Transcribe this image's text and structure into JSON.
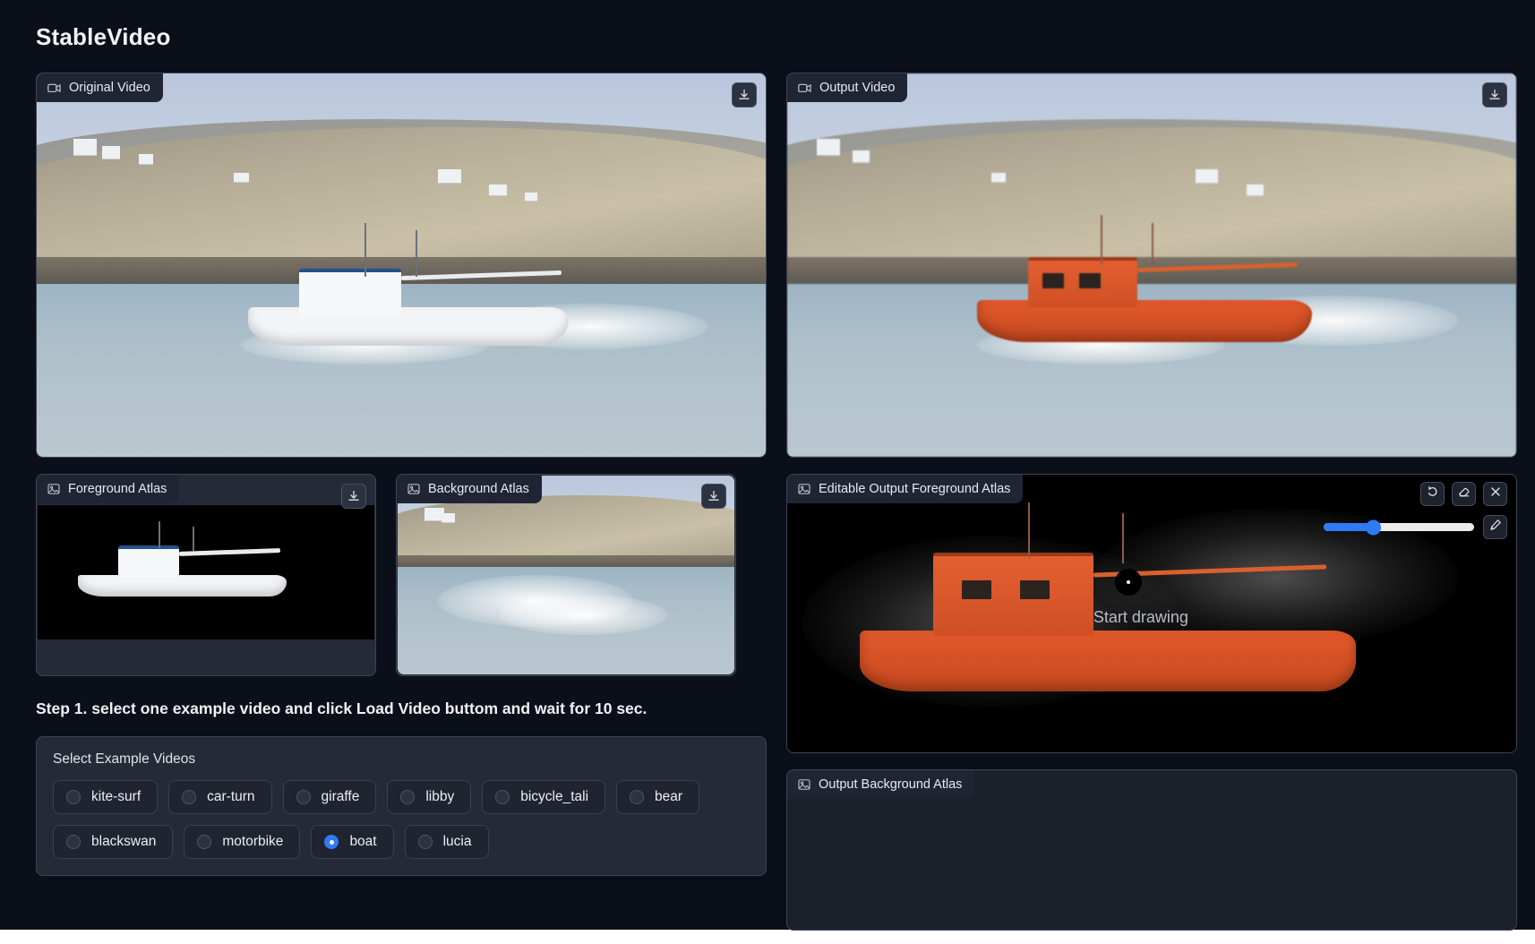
{
  "app": {
    "title": "StableVideo",
    "background_color": "#0b0f19",
    "accent_color": "#2f7bf6"
  },
  "panels": {
    "original_video": {
      "label": "Original Video",
      "icon": "video-camera-icon",
      "download_icon": "download-icon"
    },
    "output_video": {
      "label": "Output Video",
      "icon": "video-camera-icon",
      "download_icon": "download-icon"
    },
    "foreground_atlas": {
      "label": "Foreground Atlas",
      "icon": "image-icon",
      "download_icon": "download-icon"
    },
    "background_atlas": {
      "label": "Background Atlas",
      "icon": "image-icon",
      "download_icon": "download-icon"
    },
    "editable_output_foreground_atlas": {
      "label": "Editable Output Foreground Atlas",
      "icon": "image-icon",
      "hint": "Start drawing",
      "tools": [
        {
          "name": "undo-icon",
          "label": "Undo"
        },
        {
          "name": "eraser-icon",
          "label": "Erase"
        },
        {
          "name": "close-icon",
          "label": "Clear"
        }
      ],
      "brush": {
        "slider_value": 33,
        "slider_min": 0,
        "slider_max": 100,
        "pen_icon": "pen-icon"
      }
    },
    "output_background_atlas": {
      "label": "Output Background Atlas",
      "icon": "image-icon"
    }
  },
  "instructions": {
    "step1": "Step 1. select one example video and click Load Video buttom and wait for 10 sec."
  },
  "example_videos": {
    "title": "Select Example Videos",
    "selected": "boat",
    "rows": [
      [
        {
          "label": "kite-surf",
          "selected": false
        },
        {
          "label": "car-turn",
          "selected": false
        },
        {
          "label": "giraffe",
          "selected": false
        },
        {
          "label": "libby",
          "selected": false
        },
        {
          "label": "bicycle_tali",
          "selected": false
        },
        {
          "label": "bear",
          "selected": false
        }
      ],
      [
        {
          "label": "blackswan",
          "selected": false
        },
        {
          "label": "motorbike",
          "selected": false
        },
        {
          "label": "boat",
          "selected": true
        },
        {
          "label": "lucia",
          "selected": false
        }
      ]
    ]
  }
}
